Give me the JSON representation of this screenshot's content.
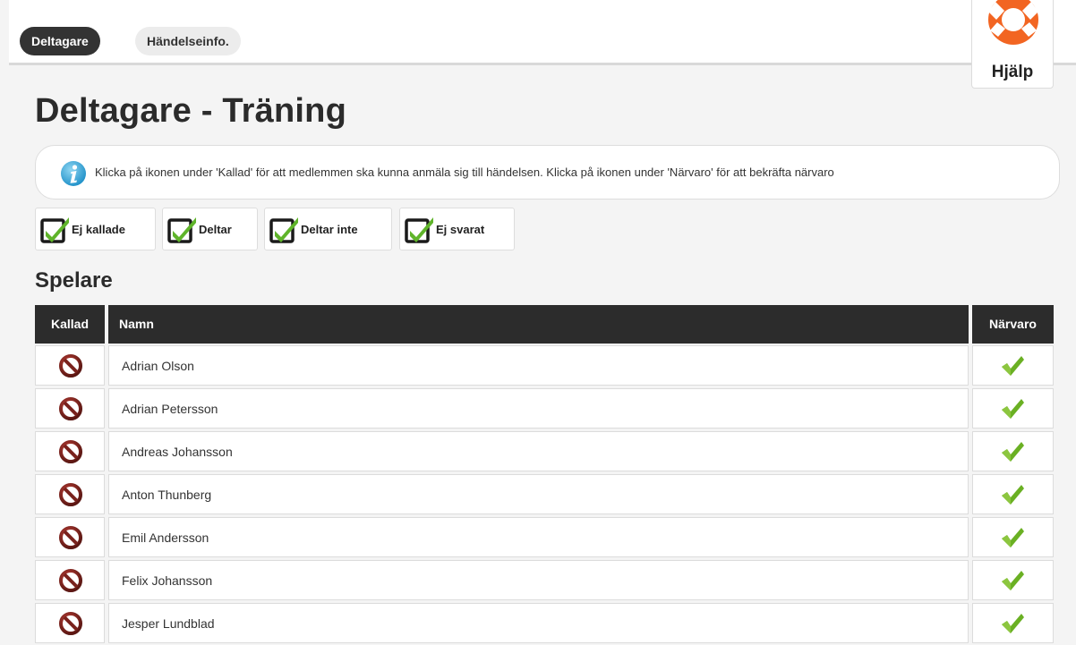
{
  "tabs": [
    {
      "label": "Deltagare",
      "active": true
    },
    {
      "label": "Händelseinfo.",
      "active": false
    }
  ],
  "help": {
    "label": "Hjälp",
    "icon": "lifebuoy-icon"
  },
  "page_title": "Deltagare - Träning",
  "info": {
    "icon": "info-icon",
    "text": "Klicka på ikonen under 'Kallad' för att medlemmen ska kunna anmäla sig till händelsen. Klicka på ikonen under 'Närvaro' för att bekräfta närvaro"
  },
  "filters": [
    {
      "label": "Ej kallade",
      "icon": "checkbox-checked-icon"
    },
    {
      "label": "Deltar",
      "icon": "checkbox-checked-icon"
    },
    {
      "label": "Deltar inte",
      "icon": "checkbox-checked-icon"
    },
    {
      "label": "Ej svarat",
      "icon": "checkbox-checked-icon"
    }
  ],
  "section_title": "Spelare",
  "table": {
    "headers": {
      "kallad": "Kallad",
      "namn": "Namn",
      "narvaro": "Närvaro"
    },
    "rows": [
      {
        "name": "Adrian Olson",
        "kallad": "ban-icon",
        "narvaro": "checkmark-icon"
      },
      {
        "name": "Adrian Petersson",
        "kallad": "ban-icon",
        "narvaro": "checkmark-icon"
      },
      {
        "name": "Andreas Johansson",
        "kallad": "ban-icon",
        "narvaro": "checkmark-icon"
      },
      {
        "name": "Anton Thunberg",
        "kallad": "ban-icon",
        "narvaro": "checkmark-icon"
      },
      {
        "name": "Emil Andersson",
        "kallad": "ban-icon",
        "narvaro": "checkmark-icon"
      },
      {
        "name": "Felix Johansson",
        "kallad": "ban-icon",
        "narvaro": "checkmark-icon"
      },
      {
        "name": "Jesper Lundblad",
        "kallad": "ban-icon",
        "narvaro": "checkmark-icon"
      }
    ]
  },
  "colors": {
    "header_bg": "#2c2c2c",
    "active_tab_bg": "#333333",
    "check_green": "#6ab023",
    "ban_red": "#8b2a25",
    "lifebuoy_orange": "#f26522"
  }
}
